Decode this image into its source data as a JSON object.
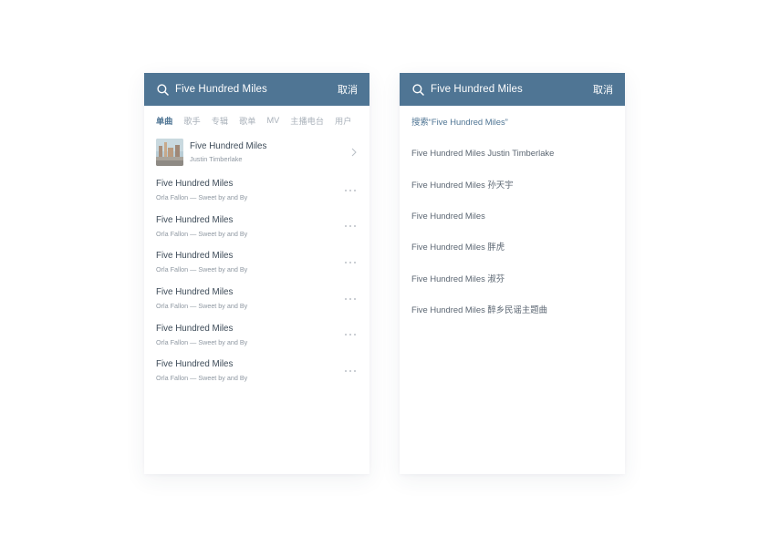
{
  "left_panel": {
    "search": {
      "query": "Five Hundred Miles",
      "cancel_label": "取消",
      "icon": "search-icon"
    },
    "tabs": [
      {
        "label": "单曲",
        "active": true
      },
      {
        "label": "歌手",
        "active": false
      },
      {
        "label": "专辑",
        "active": false
      },
      {
        "label": "歌单",
        "active": false
      },
      {
        "label": "MV",
        "active": false
      },
      {
        "label": "主播电台",
        "active": false
      },
      {
        "label": "用户",
        "active": false
      }
    ],
    "artist_card": {
      "title": "Five Hundred Miles",
      "subtitle": "Justin Timberlake",
      "icon": "chevron-right-icon"
    },
    "songs": [
      {
        "title": "Five Hundred Miles",
        "subtitle": "Orla Fallon — Sweet by and By"
      },
      {
        "title": "Five Hundred Miles",
        "subtitle": "Orla Fallon — Sweet by and By"
      },
      {
        "title": "Five Hundred Miles",
        "subtitle": "Orla Fallon — Sweet by and By"
      },
      {
        "title": "Five Hundred Miles",
        "subtitle": "Orla Fallon — Sweet by and By"
      },
      {
        "title": "Five Hundred Miles",
        "subtitle": "Orla Fallon — Sweet by and By"
      },
      {
        "title": "Five Hundred Miles",
        "subtitle": "Orla Fallon — Sweet by and By"
      }
    ]
  },
  "right_panel": {
    "search": {
      "query": "Five Hundred Miles",
      "cancel_label": "取消",
      "icon": "search-icon"
    },
    "suggestions": [
      "搜索“Five Hundred Miles”",
      "Five Hundred Miles Justin Timberlake",
      "Five Hundred Miles 孙天宇",
      "Five Hundred Miles",
      "Five Hundred Miles  胖虎",
      "Five Hundred Miles 淑芬",
      "Five Hundred Miles 醉乡民谣主题曲"
    ]
  },
  "colors": {
    "header_bg": "#4f7594",
    "accent": "#4f7594",
    "text_primary": "#3d4b58",
    "text_secondary": "#8f98a2",
    "tab_inactive": "#a9b1ba"
  }
}
